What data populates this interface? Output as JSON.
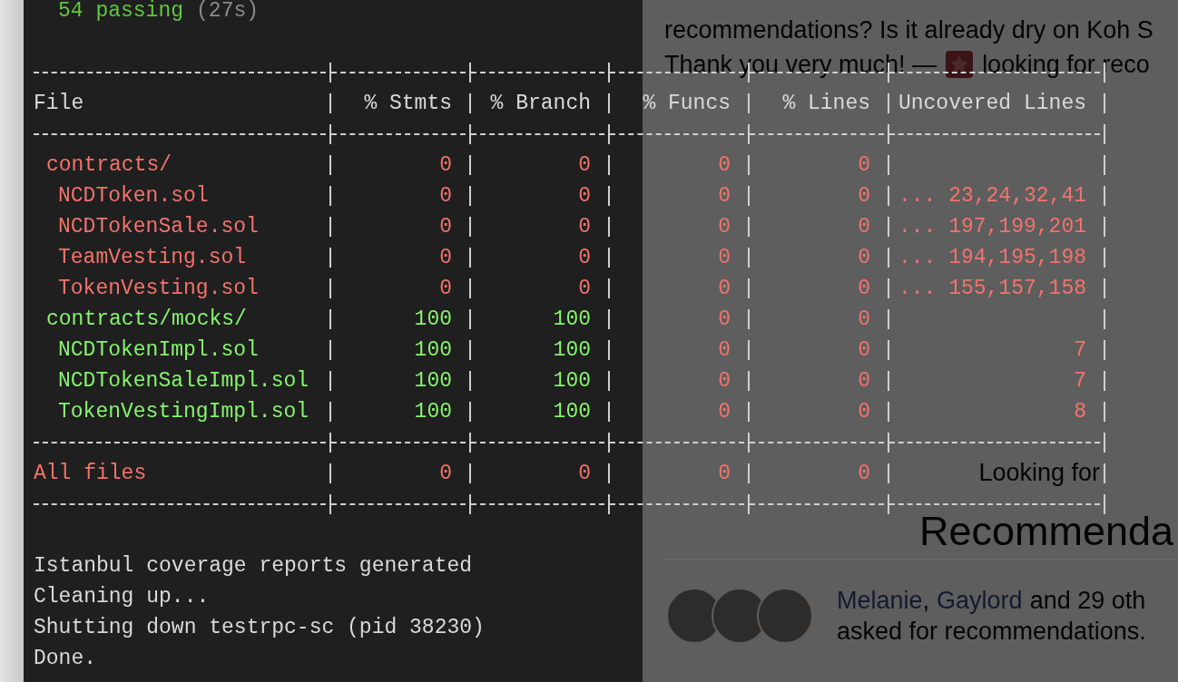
{
  "terminal": {
    "summary": {
      "passing": "54 passing",
      "duration": "(27s)"
    },
    "table": {
      "columns": [
        "File",
        "% Stmts",
        "% Branch",
        "% Funcs",
        "% Lines",
        "Uncovered Lines"
      ],
      "rows": [
        {
          "kind": "directory",
          "file": "contracts/",
          "ok": false,
          "metrics": [
            {
              "value": "0",
              "ok": false
            },
            {
              "value": "0",
              "ok": false
            },
            {
              "value": "0",
              "ok": false
            },
            {
              "value": "0",
              "ok": false
            }
          ]
        },
        {
          "kind": "file",
          "file": "NCDToken.sol",
          "ok": false,
          "metrics": [
            {
              "value": "0",
              "ok": false
            },
            {
              "value": "0",
              "ok": false
            },
            {
              "value": "0",
              "ok": false
            },
            {
              "value": "0",
              "ok": false
            }
          ],
          "uncovered": "... 23,24,32,41"
        },
        {
          "kind": "file",
          "file": "NCDTokenSale.sol",
          "ok": false,
          "metrics": [
            {
              "value": "0",
              "ok": false
            },
            {
              "value": "0",
              "ok": false
            },
            {
              "value": "0",
              "ok": false
            },
            {
              "value": "0",
              "ok": false
            }
          ],
          "uncovered": "... 197,199,201"
        },
        {
          "kind": "file",
          "file": "TeamVesting.sol",
          "ok": false,
          "metrics": [
            {
              "value": "0",
              "ok": false
            },
            {
              "value": "0",
              "ok": false
            },
            {
              "value": "0",
              "ok": false
            },
            {
              "value": "0",
              "ok": false
            }
          ],
          "uncovered": "... 194,195,198"
        },
        {
          "kind": "file",
          "file": "TokenVesting.sol",
          "ok": false,
          "metrics": [
            {
              "value": "0",
              "ok": false
            },
            {
              "value": "0",
              "ok": false
            },
            {
              "value": "0",
              "ok": false
            },
            {
              "value": "0",
              "ok": false
            }
          ],
          "uncovered": "... 155,157,158"
        },
        {
          "kind": "directory",
          "file": "contracts/mocks/",
          "ok": true,
          "metrics": [
            {
              "value": "100",
              "ok": true
            },
            {
              "value": "100",
              "ok": true
            },
            {
              "value": "0",
              "ok": false
            },
            {
              "value": "0",
              "ok": false
            }
          ]
        },
        {
          "kind": "file",
          "file": "NCDTokenImpl.sol",
          "ok": true,
          "metrics": [
            {
              "value": "100",
              "ok": true
            },
            {
              "value": "100",
              "ok": true
            },
            {
              "value": "0",
              "ok": false
            },
            {
              "value": "0",
              "ok": false
            }
          ],
          "uncovered": "7"
        },
        {
          "kind": "file",
          "file": "NCDTokenSaleImpl.sol",
          "ok": true,
          "metrics": [
            {
              "value": "100",
              "ok": true
            },
            {
              "value": "100",
              "ok": true
            },
            {
              "value": "0",
              "ok": false
            },
            {
              "value": "0",
              "ok": false
            }
          ],
          "uncovered": "7"
        },
        {
          "kind": "file",
          "file": "TokenVestingImpl.sol",
          "ok": true,
          "metrics": [
            {
              "value": "100",
              "ok": true
            },
            {
              "value": "100",
              "ok": true
            },
            {
              "value": "0",
              "ok": false
            },
            {
              "value": "0",
              "ok": false
            }
          ],
          "uncovered": "8"
        }
      ],
      "total": {
        "kind": "total",
        "file": "All files",
        "ok": false,
        "metrics": [
          {
            "value": "0",
            "ok": false
          },
          {
            "value": "0",
            "ok": false
          },
          {
            "value": "0",
            "ok": false
          },
          {
            "value": "0",
            "ok": false
          }
        ]
      }
    },
    "log": [
      "Istanbul coverage reports generated",
      "Cleaning up...",
      "Shutting down testrpc-sc (pid 38230)",
      "Done."
    ]
  },
  "background_page": {
    "paragraph": [
      "recommendations? Is it already dry on Koh S"
    ],
    "thanks": "Thank you very much! —",
    "thanks_tail": "looking for reco",
    "subtitle": "Looking for",
    "heading": "Recommenda",
    "people": [
      "Melanie",
      "Gaylord"
    ],
    "separator": ",",
    "others": "and 29 oth",
    "asked": "asked for recommendations."
  }
}
